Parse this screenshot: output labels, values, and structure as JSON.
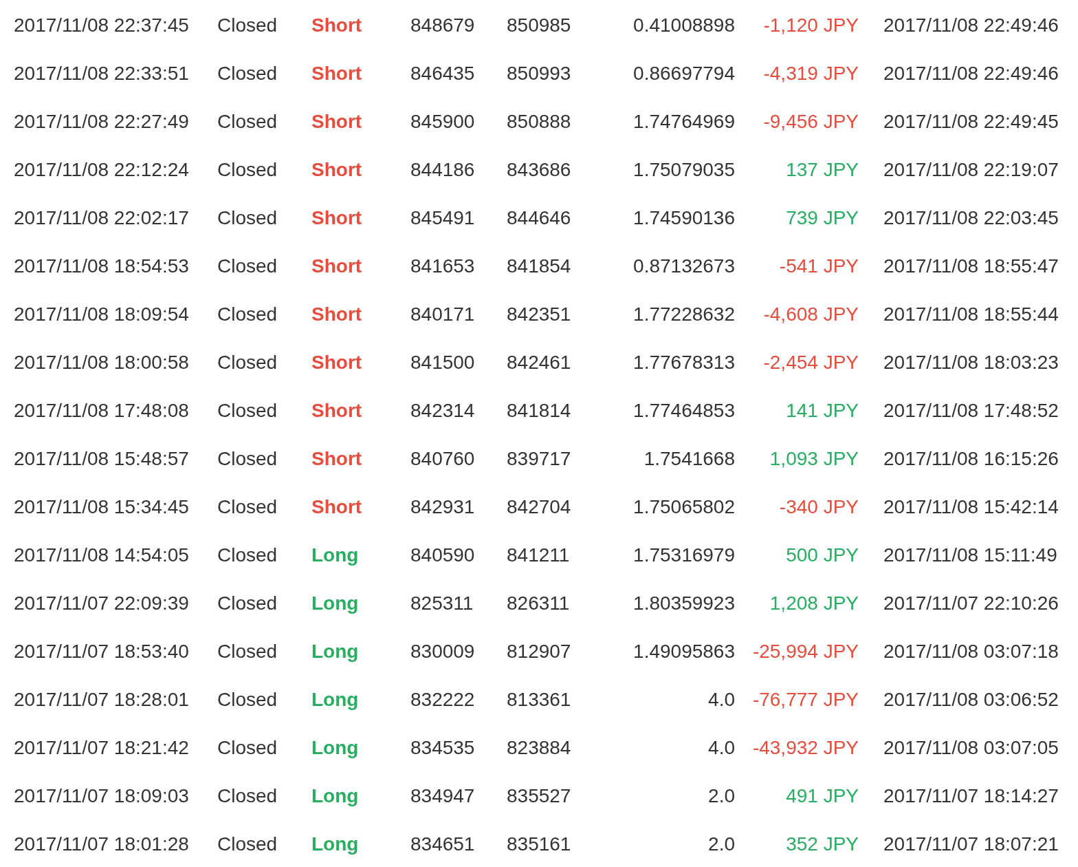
{
  "table": {
    "rows": [
      {
        "column_1": "2017/11/08 22:37:45",
        "column_2": "Closed",
        "column_3": {
          "text": "Short",
          "color": "#e74c3c"
        },
        "column_4": "848679",
        "column_5": "850985",
        "column_6": "0.41008898",
        "column_7": {
          "text": "-1,120 JPY",
          "color": "#e74c3c"
        },
        "column_8": "2017/11/08 22:49:46"
      },
      {
        "column_1": "2017/11/08 22:33:51",
        "column_2": "Closed",
        "column_3": {
          "text": "Short",
          "color": "#e74c3c"
        },
        "column_4": "846435",
        "column_5": "850993",
        "column_6": "0.86697794",
        "column_7": {
          "text": "-4,319 JPY",
          "color": "#e74c3c"
        },
        "column_8": "2017/11/08 22:49:46"
      },
      {
        "column_1": "2017/11/08 22:27:49",
        "column_2": "Closed",
        "column_3": {
          "text": "Short",
          "color": "#e74c3c"
        },
        "column_4": "845900",
        "column_5": "850888",
        "column_6": "1.74764969",
        "column_7": {
          "text": "-9,456 JPY",
          "color": "#e74c3c"
        },
        "column_8": "2017/11/08 22:49:45"
      },
      {
        "column_1": "2017/11/08 22:12:24",
        "column_2": "Closed",
        "column_3": {
          "text": "Short",
          "color": "#e74c3c"
        },
        "column_4": "844186",
        "column_5": "843686",
        "column_6": "1.75079035",
        "column_7": {
          "text": "137 JPY",
          "color": "#27ae60"
        },
        "column_8": "2017/11/08 22:19:07"
      },
      {
        "column_1": "2017/11/08 22:02:17",
        "column_2": "Closed",
        "column_3": {
          "text": "Short",
          "color": "#e74c3c"
        },
        "column_4": "845491",
        "column_5": "844646",
        "column_6": "1.74590136",
        "column_7": {
          "text": "739 JPY",
          "color": "#27ae60"
        },
        "column_8": "2017/11/08 22:03:45"
      },
      {
        "column_1": "2017/11/08 18:54:53",
        "column_2": "Closed",
        "column_3": {
          "text": "Short",
          "color": "#e74c3c"
        },
        "column_4": "841653",
        "column_5": "841854",
        "column_6": "0.87132673",
        "column_7": {
          "text": "-541 JPY",
          "color": "#e74c3c"
        },
        "column_8": "2017/11/08 18:55:47"
      },
      {
        "column_1": "2017/11/08 18:09:54",
        "column_2": "Closed",
        "column_3": {
          "text": "Short",
          "color": "#e74c3c"
        },
        "column_4": "840171",
        "column_5": "842351",
        "column_6": "1.77228632",
        "column_7": {
          "text": "-4,608 JPY",
          "color": "#e74c3c"
        },
        "column_8": "2017/11/08 18:55:44"
      },
      {
        "column_1": "2017/11/08 18:00:58",
        "column_2": "Closed",
        "column_3": {
          "text": "Short",
          "color": "#e74c3c"
        },
        "column_4": "841500",
        "column_5": "842461",
        "column_6": "1.77678313",
        "column_7": {
          "text": "-2,454 JPY",
          "color": "#e74c3c"
        },
        "column_8": "2017/11/08 18:03:23"
      },
      {
        "column_1": "2017/11/08 17:48:08",
        "column_2": "Closed",
        "column_3": {
          "text": "Short",
          "color": "#e74c3c"
        },
        "column_4": "842314",
        "column_5": "841814",
        "column_6": "1.77464853",
        "column_7": {
          "text": "141 JPY",
          "color": "#27ae60"
        },
        "column_8": "2017/11/08 17:48:52"
      },
      {
        "column_1": "2017/11/08 15:48:57",
        "column_2": "Closed",
        "column_3": {
          "text": "Short",
          "color": "#e74c3c"
        },
        "column_4": "840760",
        "column_5": "839717",
        "column_6": "1.7541668",
        "column_7": {
          "text": "1,093 JPY",
          "color": "#27ae60"
        },
        "column_8": "2017/11/08 16:15:26"
      },
      {
        "column_1": "2017/11/08 15:34:45",
        "column_2": "Closed",
        "column_3": {
          "text": "Short",
          "color": "#e74c3c"
        },
        "column_4": "842931",
        "column_5": "842704",
        "column_6": "1.75065802",
        "column_7": {
          "text": "-340 JPY",
          "color": "#e74c3c"
        },
        "column_8": "2017/11/08 15:42:14"
      },
      {
        "column_1": "2017/11/08 14:54:05",
        "column_2": "Closed",
        "column_3": {
          "text": "Long",
          "color": "#27ae60"
        },
        "column_4": "840590",
        "column_5": "841211",
        "column_6": "1.75316979",
        "column_7": {
          "text": "500 JPY",
          "color": "#27ae60"
        },
        "column_8": "2017/11/08 15:11:49"
      },
      {
        "column_1": "2017/11/07 22:09:39",
        "column_2": "Closed",
        "column_3": {
          "text": "Long",
          "color": "#27ae60"
        },
        "column_4": "825311",
        "column_5": "826311",
        "column_6": "1.80359923",
        "column_7": {
          "text": "1,208 JPY",
          "color": "#27ae60"
        },
        "column_8": "2017/11/07 22:10:26"
      },
      {
        "column_1": "2017/11/07 18:53:40",
        "column_2": "Closed",
        "column_3": {
          "text": "Long",
          "color": "#27ae60"
        },
        "column_4": "830009",
        "column_5": "812907",
        "column_6": "1.49095863",
        "column_7": {
          "text": "-25,994 JPY",
          "color": "#e74c3c"
        },
        "column_8": "2017/11/08 03:07:18"
      },
      {
        "column_1": "2017/11/07 18:28:01",
        "column_2": "Closed",
        "column_3": {
          "text": "Long",
          "color": "#27ae60"
        },
        "column_4": "832222",
        "column_5": "813361",
        "column_6": "4.0",
        "column_7": {
          "text": "-76,777 JPY",
          "color": "#e74c3c"
        },
        "column_8": "2017/11/08 03:06:52"
      },
      {
        "column_1": "2017/11/07 18:21:42",
        "column_2": "Closed",
        "column_3": {
          "text": "Long",
          "color": "#27ae60"
        },
        "column_4": "834535",
        "column_5": "823884",
        "column_6": "4.0",
        "column_7": {
          "text": "-43,932 JPY",
          "color": "#e74c3c"
        },
        "column_8": "2017/11/08 03:07:05"
      },
      {
        "column_1": "2017/11/07 18:09:03",
        "column_2": "Closed",
        "column_3": {
          "text": "Long",
          "color": "#27ae60"
        },
        "column_4": "834947",
        "column_5": "835527",
        "column_6": "2.0",
        "column_7": {
          "text": "491 JPY",
          "color": "#27ae60"
        },
        "column_8": "2017/11/07 18:14:27"
      },
      {
        "column_1": "2017/11/07 18:01:28",
        "column_2": "Closed",
        "column_3": {
          "text": "Long",
          "color": "#27ae60"
        },
        "column_4": "834651",
        "column_5": "835161",
        "column_6": "2.0",
        "column_7": {
          "text": "352 JPY",
          "color": "#27ae60"
        },
        "column_8": "2017/11/07 18:07:21"
      }
    ]
  }
}
